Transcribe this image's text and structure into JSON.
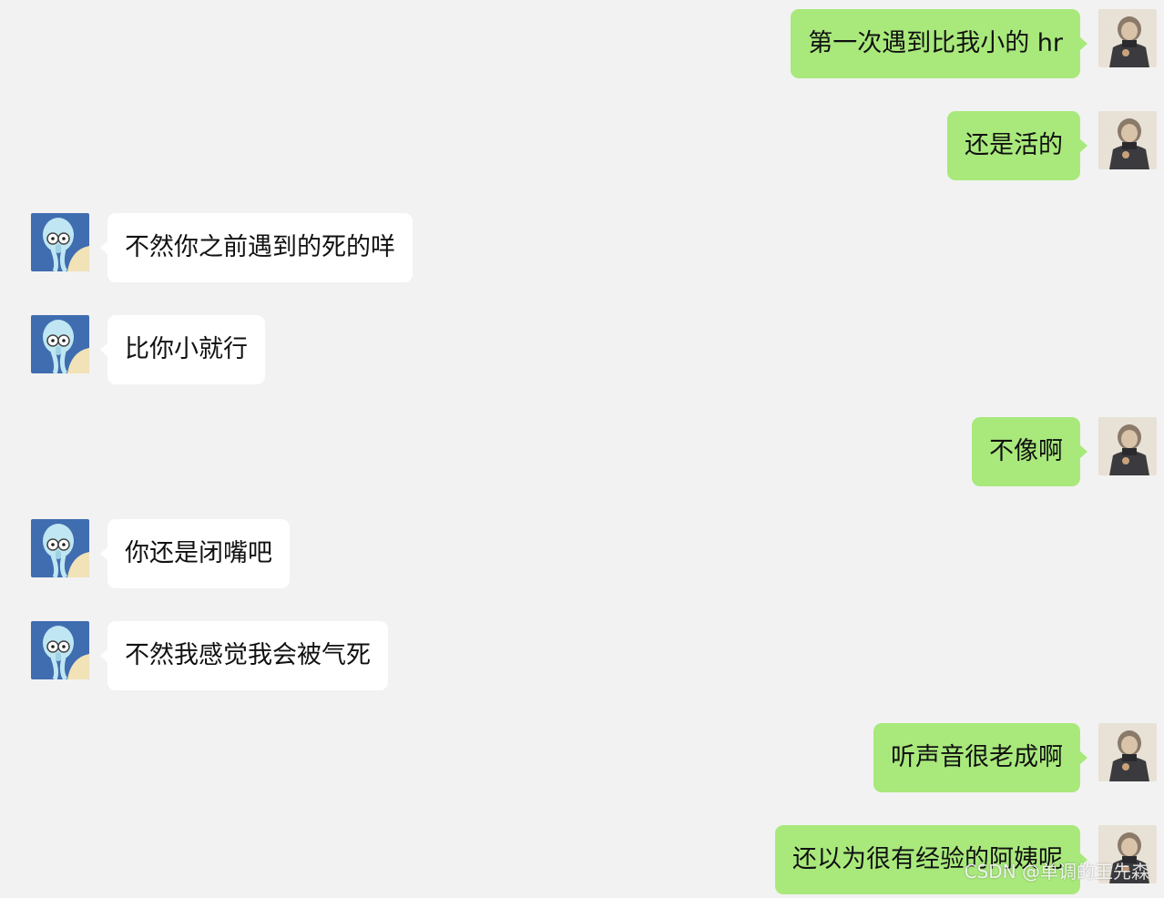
{
  "messages": [
    {
      "side": "out",
      "text": "第一次遇到比我小的 hr"
    },
    {
      "side": "out",
      "text": "还是活的"
    },
    {
      "side": "in",
      "text": "不然你之前遇到的死的咩"
    },
    {
      "side": "in",
      "text": "比你小就行"
    },
    {
      "side": "out",
      "text": "不像啊"
    },
    {
      "side": "in",
      "text": "你还是闭嘴吧"
    },
    {
      "side": "in",
      "text": "不然我感觉我会被气死"
    },
    {
      "side": "out",
      "text": "听声音很老成啊"
    },
    {
      "side": "out",
      "text": "还以为很有经验的阿姨呢"
    }
  ],
  "avatars": {
    "self": "person-in-dark-coat-avatar",
    "other": "cartoon-squid-avatar"
  },
  "colors": {
    "background": "#f2f2f2",
    "outgoing_bubble": "#a9e97c",
    "incoming_bubble": "#ffffff",
    "text": "#111111"
  },
  "watermark": "CSDN @单调的王先森"
}
